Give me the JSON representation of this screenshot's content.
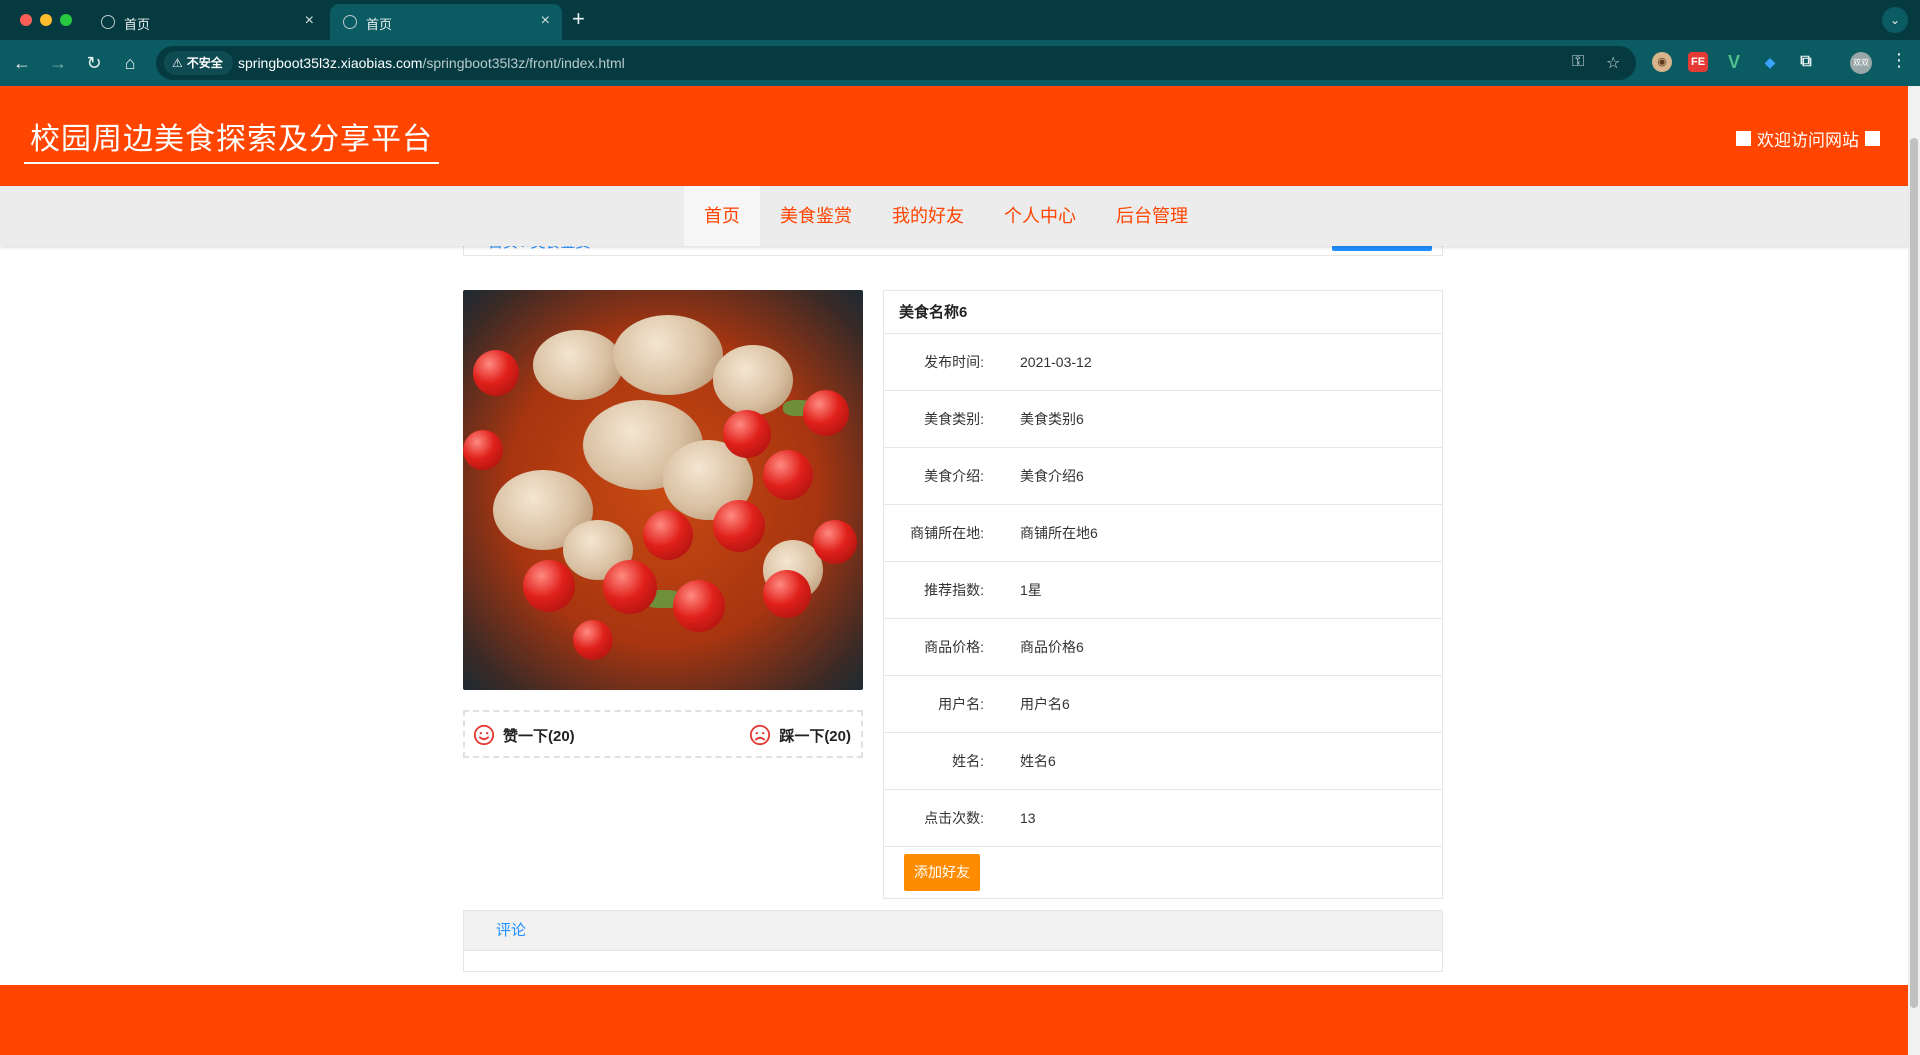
{
  "browser": {
    "tabs": [
      {
        "title": "首页",
        "close": "×"
      },
      {
        "title": "首页",
        "close": "×"
      }
    ],
    "new_tab": "+",
    "insecure_label": "不安全",
    "url_host": "springboot35l3z.xiaobias.com",
    "url_path": "/springboot35l3z/front/index.html",
    "extensions": {
      "fe": "FE",
      "v": "V"
    },
    "profile_label": "双双"
  },
  "site": {
    "title": "校园周边美食探索及分享平台",
    "welcome": "欢迎访问网站"
  },
  "nav": {
    "items": [
      "首页",
      "美食鉴赏",
      "我的好友",
      "个人中心",
      "后台管理"
    ],
    "active_index": 0
  },
  "breadcrumb": {
    "text": "首页 / 美食鉴赏"
  },
  "food": {
    "name": "美食名称6",
    "fields": [
      {
        "label": "发布时间:",
        "value": "2021-03-12"
      },
      {
        "label": "美食类别:",
        "value": "美食类别6"
      },
      {
        "label": "美食介绍:",
        "value": "美食介绍6"
      },
      {
        "label": "商铺所在地:",
        "value": "商铺所在地6"
      },
      {
        "label": "推荐指数:",
        "value": "1星"
      },
      {
        "label": "商品价格:",
        "value": "商品价格6"
      },
      {
        "label": "用户名:",
        "value": "用户名6"
      },
      {
        "label": "姓名:",
        "value": "姓名6"
      },
      {
        "label": "点击次数:",
        "value": "13"
      }
    ],
    "add_friend_label": "添加好友",
    "like_label": "赞一下(20)",
    "dislike_label": "踩一下(20)"
  },
  "comments": {
    "tab_label": "评论"
  },
  "colors": {
    "brand": "#ff4500",
    "link": "#1e90ff",
    "action": "#ff8c00",
    "chrome": "#0b5b63"
  }
}
